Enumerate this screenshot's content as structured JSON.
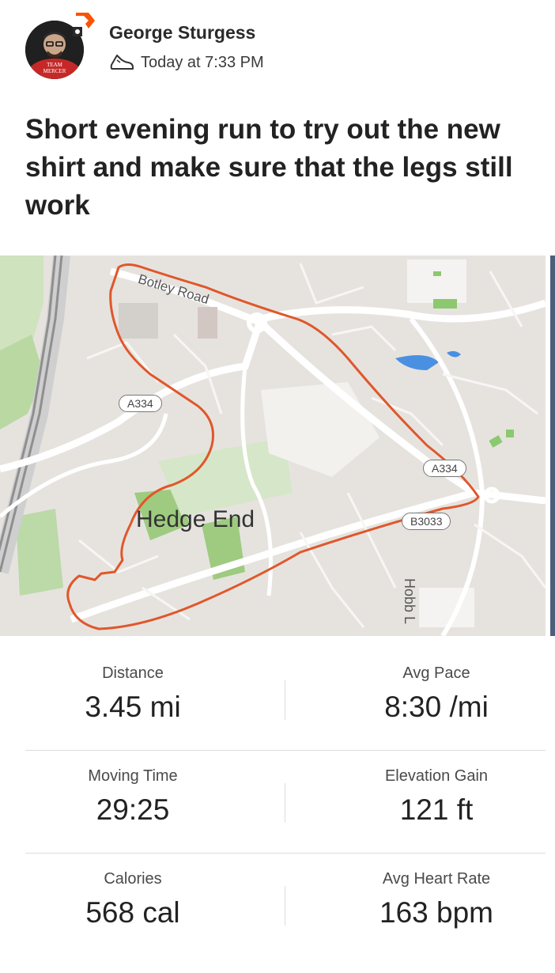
{
  "post": {
    "author": "George Sturgess",
    "timestamp": "Today at 7:33 PM",
    "title": "Short evening run to try out the new shirt and make sure that the legs still work",
    "avatar_text": "TEAM MERCER"
  },
  "map": {
    "town": "Hedge End",
    "roads": {
      "botley": "Botley Road",
      "a334_left": "A334",
      "a334_right": "A334",
      "b3033": "B3033",
      "hobb": "Hobb L"
    },
    "route_color": "#e0572a"
  },
  "stats": [
    {
      "label": "Distance",
      "value": "3.45 mi"
    },
    {
      "label": "Avg Pace",
      "value": "8:30 /mi"
    },
    {
      "label": "Moving Time",
      "value": "29:25"
    },
    {
      "label": "Elevation Gain",
      "value": "121 ft"
    },
    {
      "label": "Calories",
      "value": "568 cal"
    },
    {
      "label": "Avg Heart Rate",
      "value": "163 bpm"
    }
  ]
}
